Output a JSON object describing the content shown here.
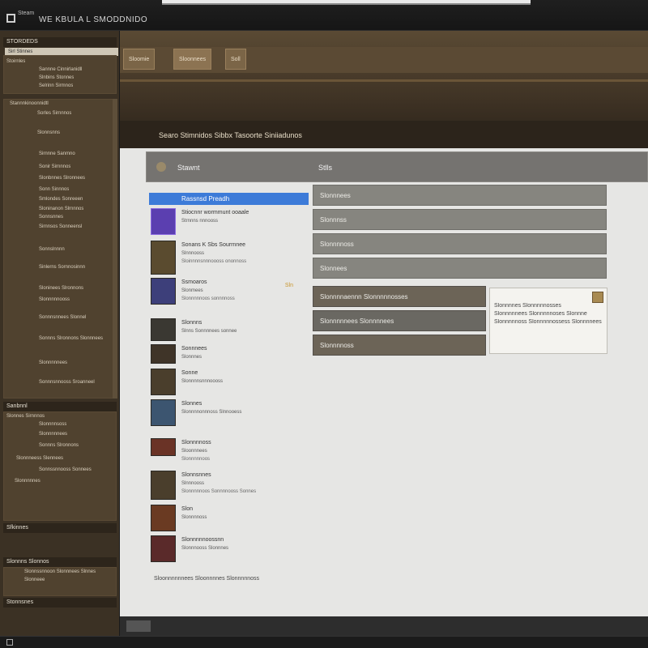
{
  "window": {
    "app_label": "Steam",
    "caption": "WE KBULA L SMODDNIDO"
  },
  "sidebar": {
    "header": "STORDEDS",
    "active_label": "Sirl Stinnes",
    "items": [
      "Stoirnles",
      "Sannne Cinnirlanidll",
      "Slnbins Stonnes",
      "Selrinn Sirmnos",
      "Stannnkinoonnidtl",
      "Sorles Sirnnnos",
      "Slonnsnns",
      "Sirnnne Sanmno",
      "Sonir Sirnnnos",
      "Slonbnnes Slronnees",
      "Sonn Sinnnos",
      "Smlondes Sonreeen",
      "Sloninanon Slrnnnos",
      "Sonnsnnes",
      "Sirnnsos Sonneensl",
      "Sonnslnnnn",
      "Sinlerns Sornnosinnn",
      "Sloninees Slronnons",
      "Slonnnnnooss",
      "Sonnnsnnees Slonnel",
      "Sonnns Slronnons Slonnnees",
      "Slonnnnnees",
      "Sonnnsnnooss Sroanneel"
    ],
    "section2": "Sanbnnl",
    "section2_items": [
      "Slonnes Sirnnnos",
      "Slonnnnsoss",
      "Slonnnnnees",
      "Sonnns Slronnons",
      "Slonnneess Slennees",
      "Sonnssnnooss Sonnees",
      "Slonnnnnes"
    ],
    "section3": "Sfkinnes",
    "section4": "Slonnns Slonnos",
    "section4_items": [
      "Slonnssnnoon Slonnnees Slnnes",
      "Slonneee"
    ],
    "section5": "Stonnsnes"
  },
  "header": {
    "tab1": "Sloomie",
    "tab2": "Sloonnees",
    "tab3": "Soll",
    "breadcrumb": "Searo Stimnidos Sibbx Tasoorte Siniiadunos"
  },
  "main": {
    "col_left": "Stawnt",
    "col_right": "Stlls",
    "selected": "Rassnsd Preadh",
    "games": [
      {
        "title": "Stiocnnr wormmunt ooaale",
        "sub": "Strnnns nnnooss",
        "meta": "",
        "badge": ""
      },
      {
        "title": "Sonans K Sbs Sourrnnee",
        "sub": "Slnnnooss",
        "meta": "Sloinnnnsnnnoooss ononnoss",
        "badge": ""
      },
      {
        "title": "Ssmoaros",
        "sub": "Slonmees",
        "meta": "Slonnnnnoos sonnnnoss",
        "badge": "Sln"
      },
      {
        "title": "Slonnns",
        "sub": "Slnns Sonnnnees sonnee",
        "meta": "",
        "badge": ""
      },
      {
        "title": "Sonnnees",
        "sub": "Slonnnes",
        "meta": "",
        "badge": ""
      },
      {
        "title": "Sonne",
        "sub": "Slonnnnsnnnoooss",
        "meta": "",
        "badge": ""
      },
      {
        "title": "Slonnes",
        "sub": "Slonnnnonnnoss Slnnooess",
        "meta": "",
        "badge": ""
      },
      {
        "title": "Slonnnnoss",
        "sub": "Sloonnnees",
        "meta": "Slonnnnnoos",
        "badge": ""
      },
      {
        "title": "Slonnsnnes",
        "sub": "Slnnnooss",
        "meta": "Slonnnnnoos Sonnnnooss Sonnes",
        "badge": ""
      },
      {
        "title": "Slon",
        "sub": "Slonnnnoss",
        "meta": "",
        "badge": ""
      },
      {
        "title": "Slonnnnnoossnn",
        "sub": "Slonnnooss Slonnnes",
        "meta": "",
        "badge": ""
      }
    ],
    "list_footer": "Sloonnnnnnees Sloonnnnes Slonnnnnoss",
    "right_buttons": [
      "Slonnnees",
      "Slonnnss",
      "Slonnnnoss",
      "Slonnees"
    ],
    "dark_buttons": [
      "Slonnnnaennn Slonnnnnosses",
      "Slonnnnnees Slonnnnees",
      "Slonnnnoss"
    ],
    "tooltip": {
      "line1": "Slonnnnes Slonnnnnosses",
      "line2": "Slonnnnnees Slonnnnnoses Slonnne",
      "line3": "Slonnnnnoss Slonnnnnossess Slonnnnees"
    }
  }
}
